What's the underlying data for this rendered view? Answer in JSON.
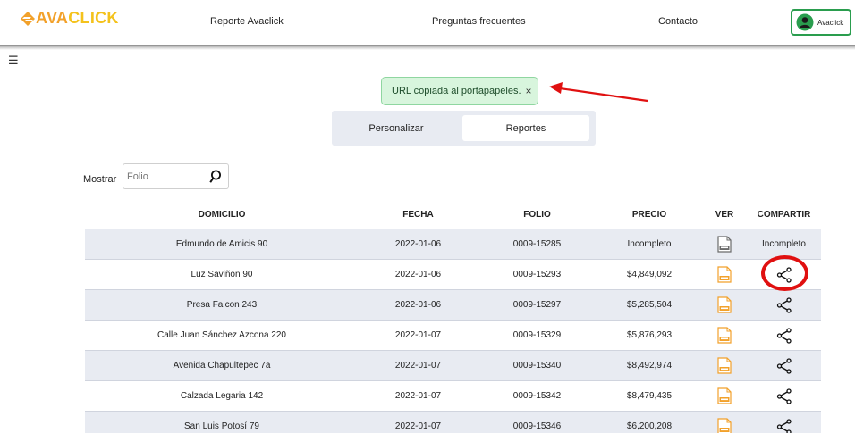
{
  "header": {
    "logo_text_1": "AVA",
    "logo_text_2": "CLICK",
    "nav": [
      {
        "label": "Reporte Avaclick"
      },
      {
        "label": "Preguntas frecuentes"
      },
      {
        "label": "Contacto"
      }
    ],
    "account_label": "Avaclick"
  },
  "menu_icon": "☰",
  "toast": {
    "message": "URL copiada al portapapeles.",
    "close": "×"
  },
  "tabs": [
    {
      "label": "Personalizar"
    },
    {
      "label": "Reportes"
    }
  ],
  "search": {
    "label": "Mostrar",
    "placeholder": "Folio"
  },
  "table": {
    "headers": [
      "DOMICILIO",
      "FECHA",
      "FOLIO",
      "PRECIO",
      "VER",
      "COMPARTIR"
    ],
    "rows": [
      {
        "domicilio": "Edmundo de Amicis 90",
        "fecha": "2022-01-06",
        "folio": "0009-15285",
        "precio": "Incompleto",
        "compartir": "Incompleto"
      },
      {
        "domicilio": "Luz Saviñon 90",
        "fecha": "2022-01-06",
        "folio": "0009-15293",
        "precio": "$4,849,092"
      },
      {
        "domicilio": "Presa Falcon 243",
        "fecha": "2022-01-06",
        "folio": "0009-15297",
        "precio": "$5,285,504"
      },
      {
        "domicilio": "Calle Juan Sánchez Azcona 220",
        "fecha": "2022-01-07",
        "folio": "0009-15329",
        "precio": "$5,876,293"
      },
      {
        "domicilio": "Avenida Chapultepec 7a",
        "fecha": "2022-01-07",
        "folio": "0009-15340",
        "precio": "$8,492,974"
      },
      {
        "domicilio": "Calzada Legaria 142",
        "fecha": "2022-01-07",
        "folio": "0009-15342",
        "precio": "$8,479,435"
      },
      {
        "domicilio": "San Luis Potosí 79",
        "fecha": "2022-01-07",
        "folio": "0009-15346",
        "precio": "$6,200,208"
      }
    ]
  },
  "colors": {
    "brand_orange": "#f2a12b",
    "brand_yellow": "#f4c21c",
    "account_green": "#2a9d4e",
    "toast_bg": "#d8f5dd",
    "annotation_red": "#e01010"
  },
  "icons": {
    "logo": "ava-diamond-logo-icon",
    "user": "user-avatar-icon",
    "search": "search-icon",
    "pdf": "pdf-icon",
    "share": "share-icon"
  }
}
